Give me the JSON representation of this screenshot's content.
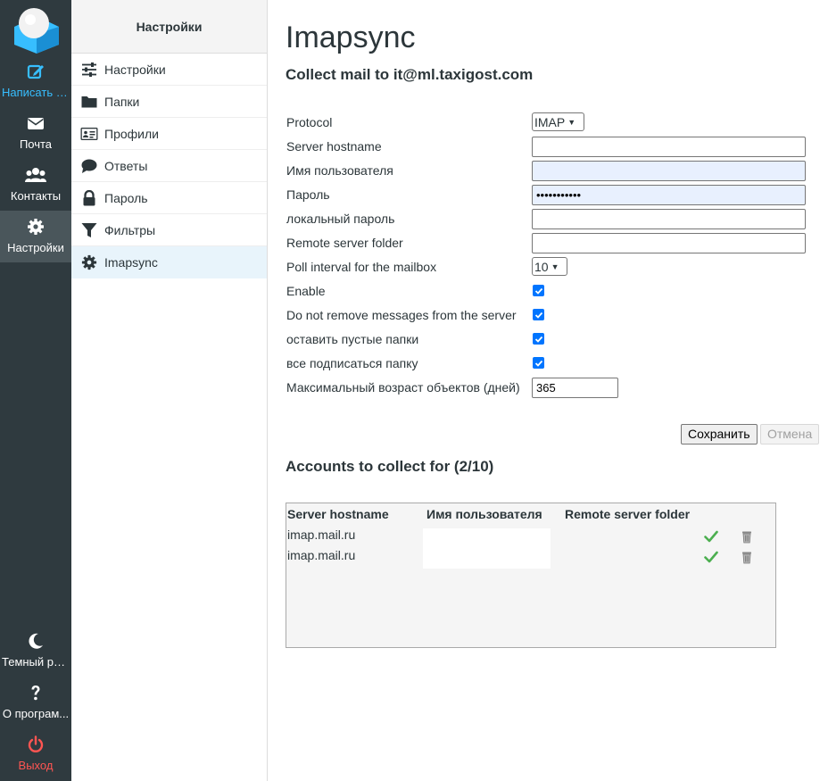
{
  "nav": {
    "compose": "Написать с...",
    "mail": "Почта",
    "contacts": "Контакты",
    "settings": "Настройки",
    "dark_mode": "Темный ре...",
    "about": "О програм...",
    "logout": "Выход"
  },
  "settings_panel": {
    "header": "Настройки",
    "items": [
      {
        "label": "Настройки",
        "icon": "sliders-icon"
      },
      {
        "label": "Папки",
        "icon": "folder-icon"
      },
      {
        "label": "Профили",
        "icon": "id-card-icon"
      },
      {
        "label": "Ответы",
        "icon": "comment-icon"
      },
      {
        "label": "Пароль",
        "icon": "lock-icon"
      },
      {
        "label": "Фильтры",
        "icon": "filter-icon"
      },
      {
        "label": "Imapsync",
        "icon": "gear-icon"
      }
    ]
  },
  "page": {
    "title": "Imapsync",
    "subtitle": "Collect mail to it@ml.taxigost.com"
  },
  "form": {
    "protocol_label": "Protocol",
    "protocol_value": "IMAP",
    "server_hostname_label": "Server hostname",
    "server_hostname_value": "",
    "username_label": "Имя пользователя",
    "username_value": "",
    "password_label": "Пароль",
    "password_value": "•••••••••••",
    "local_password_label": "локальный пароль",
    "local_password_value": "",
    "remote_folder_label": "Remote server folder",
    "remote_folder_value": "",
    "poll_interval_label": "Poll interval for the mailbox",
    "poll_interval_value": "10",
    "enable_label": "Enable",
    "do_not_remove_label": "Do not remove messages from the server",
    "keep_empty_folders_label": "оставить пустые папки",
    "subscribe_all_label": "все подписаться папку",
    "max_age_label": "Максимальный возраст объектов (дней)",
    "max_age_value": "365",
    "save": "Сохранить",
    "cancel": "Отмена"
  },
  "accounts": {
    "title": "Accounts to collect for (2/10)",
    "columns": [
      "Server hostname",
      "Имя пользователя",
      "Remote server folder"
    ],
    "rows": [
      {
        "server": "imap.mail.ru",
        "user": "",
        "folder": ""
      },
      {
        "server": "imap.mail.ru",
        "user": "",
        "folder": ""
      }
    ]
  },
  "colors": {
    "rail_bg": "#2f3a3f",
    "accent": "#37beff",
    "logout": "#ff5552",
    "check_green": "#4caf50"
  }
}
